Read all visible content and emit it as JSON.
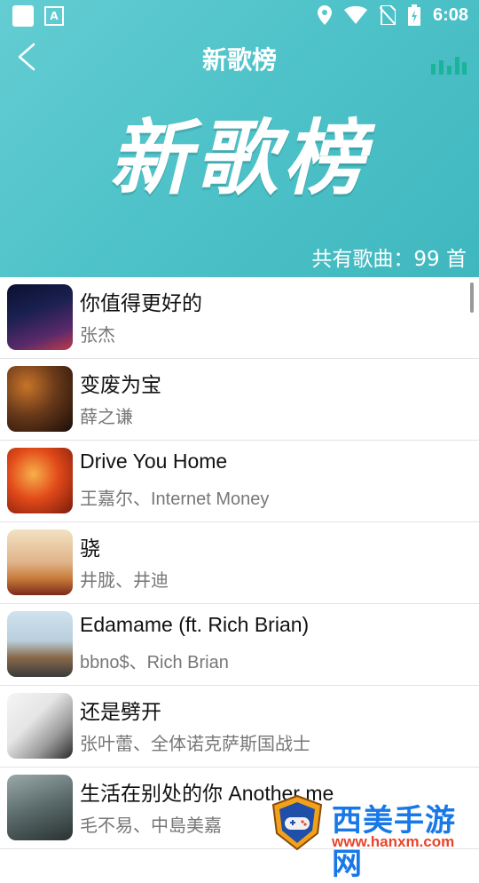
{
  "status_bar": {
    "time": "6:08",
    "notification_icons": [
      "square-icon",
      "a-icon"
    ],
    "status_icons": [
      "location-icon",
      "wifi-icon",
      "no-sim-icon",
      "battery-charging-icon"
    ]
  },
  "nav": {
    "title": "新歌榜",
    "back_icon": "chevron-left-icon",
    "playing_icon": "equalizer-icon"
  },
  "banner": {
    "text": "新歌榜"
  },
  "song_count": "共有歌曲：99 首",
  "songs": [
    {
      "title": "你值得更好的",
      "artist": "张杰",
      "cover_colors": [
        "#0b1030",
        "#5a2a6a",
        "#c03a4a"
      ]
    },
    {
      "title": "变废为宝",
      "artist": "薛之谦",
      "cover_colors": [
        "#1a0d08",
        "#6a3a1a",
        "#c8742a"
      ]
    },
    {
      "title": "Drive You Home",
      "artist": "王嘉尔、Internet Money",
      "cover_colors": [
        "#7a1a0a",
        "#e24a1a",
        "#f7b04a"
      ]
    },
    {
      "title": "骁",
      "artist": "井胧、井迪",
      "cover_colors": [
        "#f2e2c2",
        "#c87a3a",
        "#7a2a1a"
      ]
    },
    {
      "title": "Edamame (ft. Rich Brian)",
      "artist": "bbno$、Rich Brian",
      "cover_colors": [
        "#cfe2ee",
        "#8a6a4a",
        "#3a3a3a"
      ]
    },
    {
      "title": "还是劈开",
      "artist": "张叶蕾、全体诺克萨斯国战士",
      "cover_colors": [
        "#f5f5f5",
        "#cccccc",
        "#2a2a2a"
      ]
    },
    {
      "title": "生活在别处的你 Another me",
      "artist": "毛不易、中島美嘉",
      "cover_colors": [
        "#5a6a6a",
        "#2a3232",
        "#9aa8a8"
      ]
    }
  ],
  "watermark": {
    "name": "西美手游网",
    "url": "www.hanxm.com"
  }
}
